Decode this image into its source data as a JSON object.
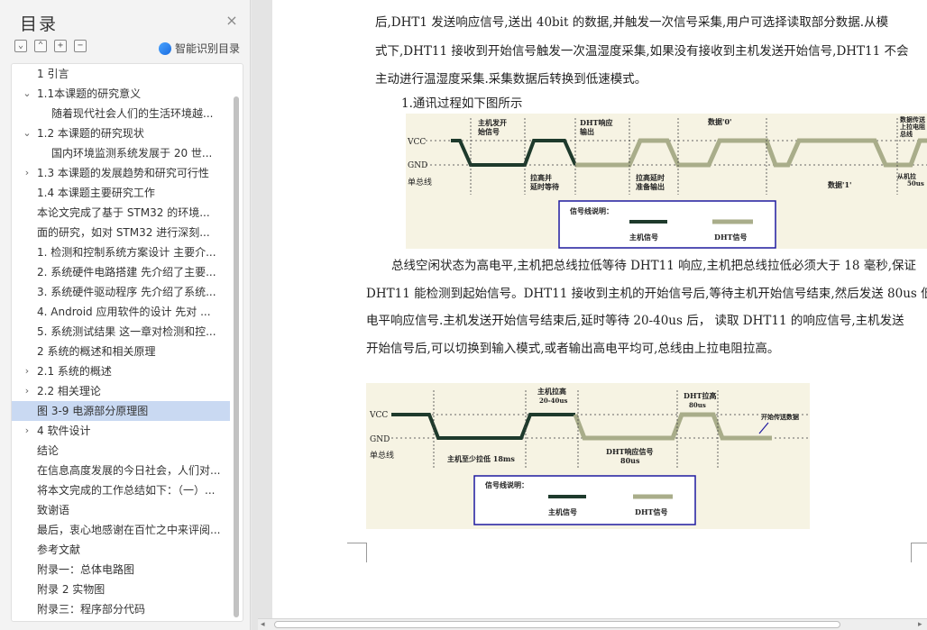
{
  "sidebar": {
    "title": "目录",
    "close": "×",
    "tools": [
      "⌄",
      "⌃",
      "+",
      "−"
    ],
    "smart_label": "智能识别目录",
    "items": [
      {
        "label": "1 引言",
        "indent": 1,
        "chev": ""
      },
      {
        "label": "1.1本课题的研究意义",
        "indent": 1,
        "chev": "down"
      },
      {
        "label": "随着现代社会人们的生活环境越...",
        "indent": 2,
        "chev": ""
      },
      {
        "label": "1.2 本课题的研究现状",
        "indent": 1,
        "chev": "down"
      },
      {
        "label": "国内环境监测系统发展于 20 世...",
        "indent": 2,
        "chev": ""
      },
      {
        "label": "1.3 本课题的发展趋势和研究可行性",
        "indent": 1,
        "chev": "right"
      },
      {
        "label": "1.4 本课题主要研究工作",
        "indent": 1,
        "chev": ""
      },
      {
        "label": "本论文完成了基于 STM32 的环境...",
        "indent": 1,
        "chev": ""
      },
      {
        "label": "面的研究，如对 STM32 进行深刻...",
        "indent": 1,
        "chev": ""
      },
      {
        "label": "1. 检测和控制系统方案设计 主要介...",
        "indent": 1,
        "chev": ""
      },
      {
        "label": "2. 系统硬件电路搭建 先介绍了主要...",
        "indent": 1,
        "chev": ""
      },
      {
        "label": "3. 系统硬件驱动程序 先介绍了系统...",
        "indent": 1,
        "chev": ""
      },
      {
        "label": "4. Android 应用软件的设计 先对 ...",
        "indent": 1,
        "chev": ""
      },
      {
        "label": "5. 系统测试结果 这一章对检测和控...",
        "indent": 1,
        "chev": ""
      },
      {
        "label": "2 系统的概述和相关原理",
        "indent": 1,
        "chev": ""
      },
      {
        "label": "2.1 系统的概述",
        "indent": 1,
        "chev": "right"
      },
      {
        "label": "2.2 相关理论",
        "indent": 1,
        "chev": "right"
      },
      {
        "label": "图 3-9 电源部分原理图",
        "indent": 1,
        "chev": "",
        "selected": true
      },
      {
        "label": "4 软件设计",
        "indent": 1,
        "chev": "right"
      },
      {
        "label": "结论",
        "indent": 1,
        "chev": ""
      },
      {
        "label": "在信息高度发展的今日社会，人们对...",
        "indent": 1,
        "chev": ""
      },
      {
        "label": "将本文完成的工作总结如下：（一）...",
        "indent": 1,
        "chev": ""
      },
      {
        "label": "致谢语",
        "indent": 1,
        "chev": ""
      },
      {
        "label": "最后，衷心地感谢在百忙之中来评阅...",
        "indent": 1,
        "chev": ""
      },
      {
        "label": "参考文献",
        "indent": 1,
        "chev": ""
      },
      {
        "label": "附录一：总体电路图",
        "indent": 1,
        "chev": ""
      },
      {
        "label": "附录 2 实物图",
        "indent": 1,
        "chev": ""
      },
      {
        "label": "附录三：程序部分代码",
        "indent": 1,
        "chev": ""
      }
    ]
  },
  "document": {
    "lines_top": [
      "后,DHT1 发送响应信号,送出 40bit 的数据,并触发一次信号采集,用户可选择读取部分数据.从模",
      "式下,DHT11 接收到开始信号触发一次温湿度采集,如果没有接收到主机发送开始信号,DHT11 不会",
      "主动进行温湿度采集.采集数据后转换到低速模式。"
    ],
    "list_item": "1.通讯过程如下图所示",
    "lines_mid": [
      "总线空闲状态为高电平,主机把总线拉低等待 DHT11 响应,主机把总线拉低必须大于 18 毫秒,保证",
      "DHT11 能检测到起始信号。DHT11 接收到主机的开始信号后,等待主机开始信号结束,然后发送 80us 低",
      "电平响应信号.主机发送开始信号结束后,延时等待 20-40us 后， 读取 DHT11 的响应信号,主机发送",
      "开始信号后,可以切换到输入模式,或者输出高电平均可,总线由上拉电阻拉高。"
    ]
  },
  "figure1": {
    "vcc": "VCC",
    "gnd": "GND",
    "bus": "单总线",
    "host_start": [
      "主机发开",
      "始信号"
    ],
    "dht_resp": [
      "DHT响应",
      "输出"
    ],
    "data0": "数据'0'",
    "pull_up": [
      "拉高并",
      "延时等待"
    ],
    "pull_delay": [
      "拉高延时",
      "准备输出"
    ],
    "data1": "数据'1'",
    "end_top": [
      "数据传送",
      "上拉电阻",
      "总线"
    ],
    "end_bottom": [
      "从机拉",
      "50us"
    ],
    "legend_title": "信号线说明：",
    "legend_host": "主机信号",
    "legend_dht": "DHT信号"
  },
  "figure2": {
    "vcc": "VCC",
    "gnd": "GND",
    "bus": "单总线",
    "host_pull": [
      "主机拉高",
      "20-40us"
    ],
    "dht_pull": [
      "DHT拉高",
      "80us"
    ],
    "start_tx": "开始传送数据",
    "host_low": "主机至少拉低 18ms",
    "dht_resp": [
      "DHT响应信号",
      "80us"
    ],
    "legend_title": "信号线说明：",
    "legend_host": "主机信号",
    "legend_dht": "DHT信号"
  },
  "colors": {
    "host_signal": "#1e3a2c",
    "dht_signal": "#a9ad8a",
    "selected": "#c9d9f2",
    "legend_border": "#1f1aa0"
  }
}
